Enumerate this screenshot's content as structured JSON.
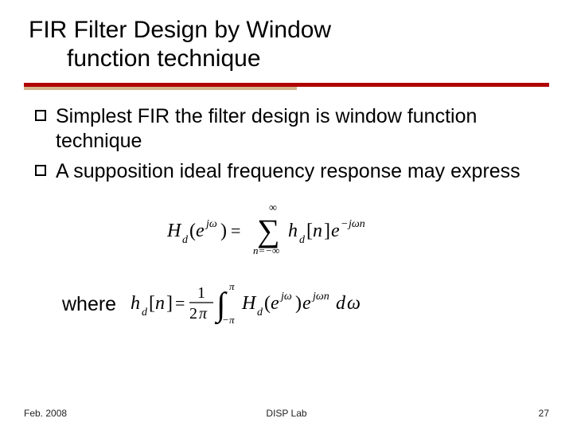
{
  "title": {
    "line1": "FIR Filter Design by Window",
    "line2": "function technique"
  },
  "bullets": [
    "Simplest FIR the filter design is window function technique",
    "A supposition ideal frequency response may express"
  ],
  "formula1_alt": "H_d(e^{jω}) = Σ_{n=-∞}^{∞} h_d[n] e^{-jωn}",
  "where_label": "where",
  "formula2_alt": "h_d[n] = (1 / 2π) ∫_{-π}^{π} H_d(e^{jω}) e^{jωn} dω",
  "footer": {
    "left": "Feb. 2008",
    "center": "DISP Lab",
    "right": "27"
  }
}
